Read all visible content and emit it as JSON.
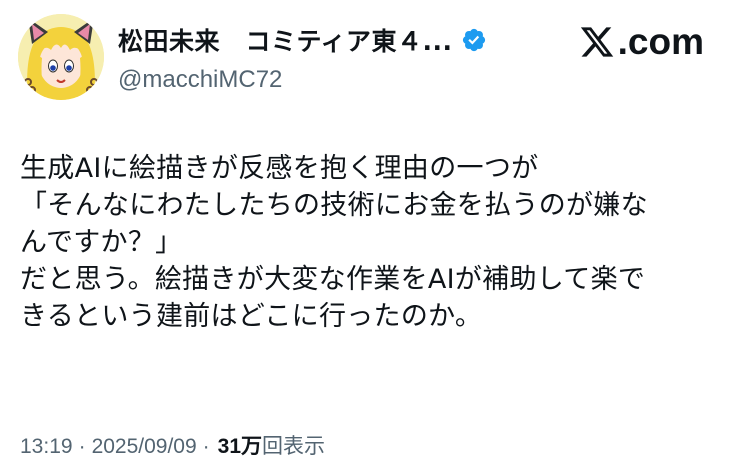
{
  "author": {
    "display_name": "松田未来　コミティア東４...",
    "handle": "@macchiMC72",
    "verified": true,
    "avatar_icon": "anime-girl-avatar-icon",
    "verified_icon": "verified-badge-icon"
  },
  "brand": {
    "logo_icon": "x-logo-icon",
    "text": ".com"
  },
  "tweet": {
    "lines": [
      "生成AIに絵描きが反感を抱く理由の一つが",
      "「そんなにわたしたちの技術にお金を払うのが嫌な",
      "んですか？」",
      "だと思う。絵描きが大変な作業をAIが補助して楽で",
      "きるという建前はどこに行ったのか。"
    ]
  },
  "meta": {
    "time": "13:19",
    "separator": "·",
    "date": "2025/09/09",
    "views_count": "31万",
    "views_label": "回表示"
  },
  "colors": {
    "text_primary": "#0f1419",
    "text_secondary": "#536471",
    "verified_blue": "#1d9bf0",
    "background": "#ffffff"
  }
}
